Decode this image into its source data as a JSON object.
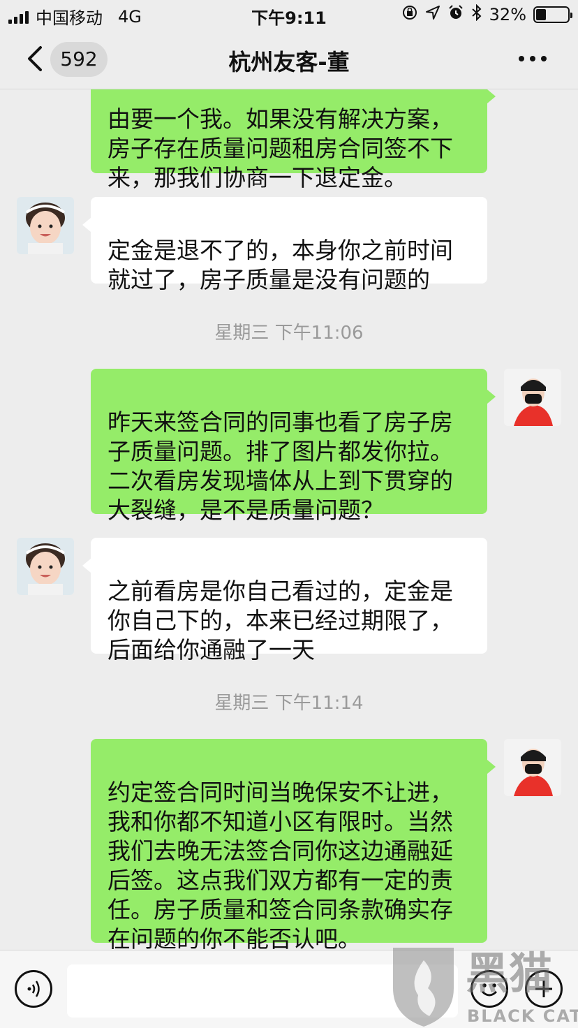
{
  "status_bar": {
    "carrier": "中国移动",
    "network": "4G",
    "time": "下午9:11",
    "battery_percent": "32%",
    "battery_level": 0.32
  },
  "nav": {
    "unread_count": "592",
    "title": "杭州友客-董",
    "back_icon": "chevron-left-icon",
    "more_icon": "more-dots-icon"
  },
  "messages": [
    {
      "sender": "me",
      "text": "由要一个我。如果没有解决方案，\n房子存在质量问题租房合同签不下\n来，那我们协商一下退定金。"
    },
    {
      "sender": "them",
      "text": "定金是退不了的，本身你之前时间\n就过了，房子质量是没有问题的"
    },
    {
      "type": "timestamp",
      "text": "星期三 下午11:06"
    },
    {
      "sender": "me",
      "text": "昨天来签合同的同事也看了房子房\n子质量问题。排了图片都发你拉。\n二次看房发现墙体从上到下贯穿的\n大裂缝，是不是质量问题？"
    },
    {
      "sender": "them",
      "text": "之前看房是你自己看过的，定金是\n你自己下的，本来已经过期限了，\n后面给你通融了一天"
    },
    {
      "type": "timestamp",
      "text": "星期三 下午11:14"
    },
    {
      "sender": "me",
      "text": "约定签合同时间当晚保安不让进，\n我和你都不知道小区有限时。当然\n我们去晚无法签合同你这边通融延\n后签。这点我们双方都有一定的责\n任。房子质量和签合同条款确实存\n在问题的你不能否认吧。"
    }
  ],
  "input_bar": {
    "voice_icon": "voice-icon",
    "emoji_icon": "emoji-icon",
    "plus_icon": "plus-icon",
    "placeholder": ""
  },
  "watermark": {
    "text_cn": "黑猫",
    "text_en": "BLACK CAT"
  },
  "colors": {
    "my_bubble": "#95ec69",
    "their_bubble": "#ffffff",
    "background": "#ededed"
  }
}
